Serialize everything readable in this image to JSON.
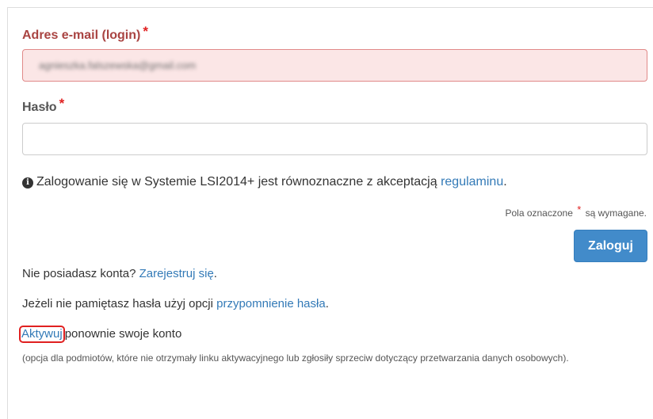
{
  "form": {
    "email": {
      "label": "Adres e-mail (login)",
      "required_mark": "*",
      "value": "agnieszka.falszewska@gmail.com"
    },
    "password": {
      "label": "Hasło",
      "required_mark": "*",
      "value": ""
    },
    "info": {
      "text": "Zalogowanie się w Systemie LSI2014+ jest równoznaczne z akceptacją ",
      "link": "regulaminu",
      "suffix": "."
    },
    "required_note": {
      "prefix": "Pola oznaczone",
      "mark": "*",
      "suffix": "są wymagane."
    },
    "login_button": "Zaloguj"
  },
  "links": {
    "register": {
      "prefix": "Nie posiadasz konta? ",
      "link": "Zarejestruj się",
      "suffix": "."
    },
    "forgot": {
      "prefix": "Jeżeli nie pamiętasz hasła użyj opcji ",
      "link": "przypomnienie hasła",
      "suffix": "."
    },
    "activate": {
      "link": "Aktywuj",
      "suffix": "ponownie swoje konto",
      "note": "(opcja dla podmiotów, które nie otrzymały linku aktywacyjnego lub zgłosiły sprzeciw dotyczący przetwarzania danych osobowych)."
    }
  },
  "colors": {
    "error": "#a94442",
    "link": "#337ab7",
    "primary": "#428bca",
    "required": "#e02020"
  },
  "icons": {
    "info": "info-circle-icon"
  }
}
